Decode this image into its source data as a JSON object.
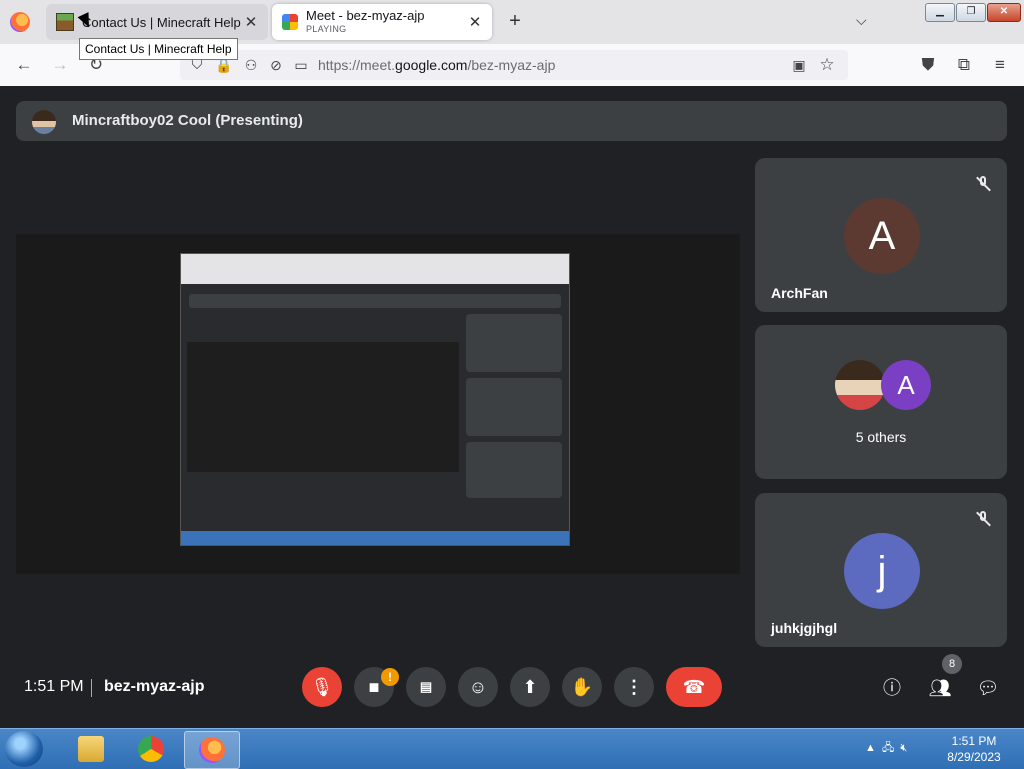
{
  "browser": {
    "tabs": [
      {
        "title": "Contact Us | Minecraft Help",
        "active": false
      },
      {
        "title": "Meet - bez-myaz-ajp",
        "status": "PLAYING",
        "active": true
      }
    ],
    "tooltip": "Contact Us | Minecraft Help",
    "url_prefix": "https://meet.",
    "url_domain": "google.com",
    "url_path": "/bez-myaz-ajp"
  },
  "meet": {
    "presenter": "Mincraftboy02 Cool (Presenting)",
    "time": "1:51 PM",
    "meeting_code": "bez-myaz-ajp",
    "participant_count": "8",
    "camera_warning": "!",
    "tiles": [
      {
        "name": "ArchFan",
        "initial": "A",
        "color": "#5d3a31",
        "muted": true
      },
      {
        "name": "5 others",
        "initial": "A",
        "color": "#7b3fc4",
        "muted": false
      },
      {
        "name": "juhkjgjhgl",
        "initial": "j",
        "color": "#5c6bc0",
        "muted": true
      }
    ],
    "colors": {
      "hangup": "#ea4335",
      "tile_bg": "#3c4043",
      "warning": "#f29900"
    }
  },
  "taskbar": {
    "time": "1:51 PM",
    "date": "8/29/2023",
    "apps": [
      "explorer-icon",
      "chrome-icon",
      "firefox-icon"
    ]
  }
}
